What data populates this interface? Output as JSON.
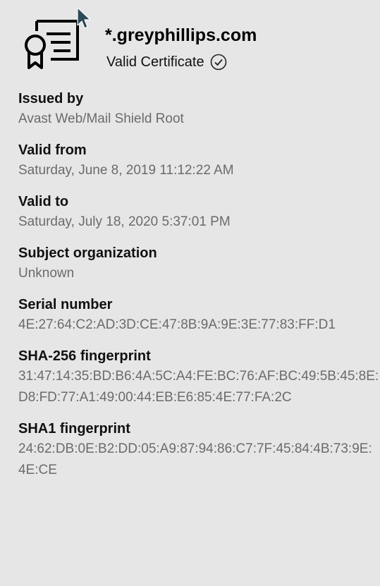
{
  "certificate": {
    "site": "*.greyphillips.com",
    "status": "Valid Certificate",
    "icon": "certificate-icon",
    "status_icon": "check-circle-icon"
  },
  "fields": {
    "issued_by": {
      "label": "Issued by",
      "value": "Avast Web/Mail Shield Root"
    },
    "valid_from": {
      "label": "Valid from",
      "value": "Saturday, June 8, 2019 11:12:22 AM"
    },
    "valid_to": {
      "label": "Valid to",
      "value": "Saturday, July 18, 2020 5:37:01 PM"
    },
    "subject_org": {
      "label": "Subject organization",
      "value": "Unknown"
    },
    "serial": {
      "label": "Serial number",
      "value": "4E:27:64:C2:AD:3D:CE:47:8B:9A:9E:3E:77:83:FF:D1"
    },
    "sha256": {
      "label": "SHA-256 fingerprint",
      "value": "31:47:14:35:BD:B6:4A:5C:A4:FE:BC:76:AF:BC:49:5B:45:8E:D8:FD:77:A1:49:00:44:EB:E6:85:4E:77:FA:2C"
    },
    "sha1": {
      "label": "SHA1 fingerprint",
      "value": "24:62:DB:0E:B2:DD:05:A9:87:94:86:C7:7F:45:84:4B:73:9E:4E:CE"
    }
  },
  "colors": {
    "background": "#e6e6e6",
    "label": "#111111",
    "value": "#6b6b6b"
  }
}
